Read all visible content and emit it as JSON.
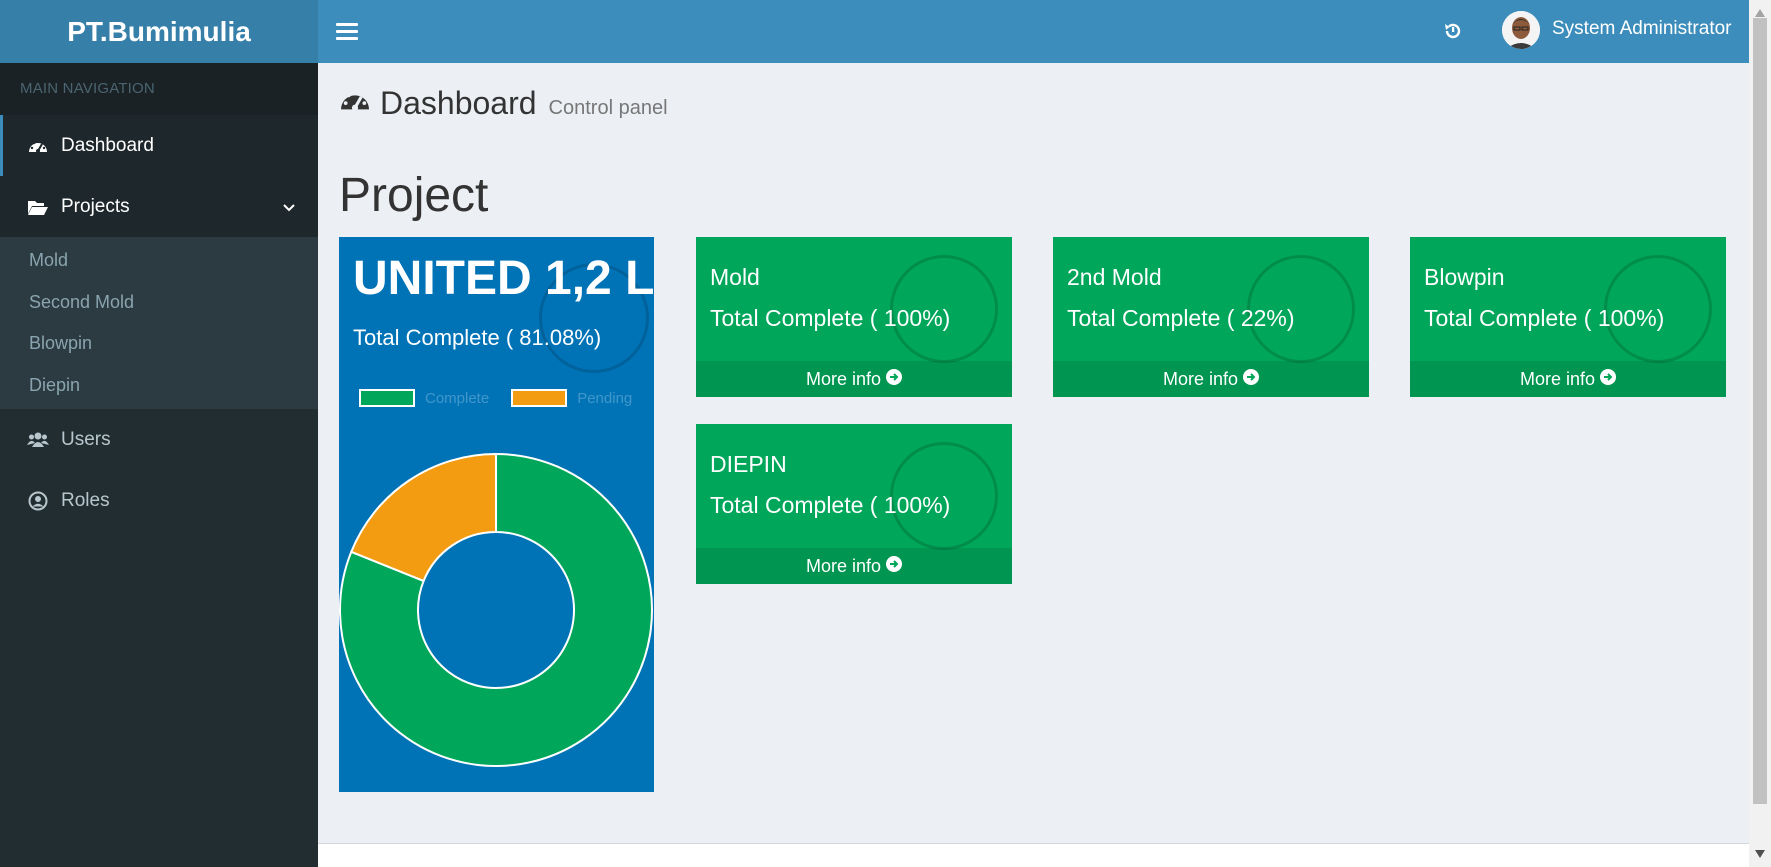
{
  "app": {
    "brand": "PT.Bumimulia"
  },
  "header": {
    "user_name": "System Administrator",
    "history_icon": "history-icon",
    "menu_icon": "hamburger-icon"
  },
  "sidebar": {
    "section_label": "MAIN NAVIGATION",
    "items": [
      {
        "label": "Dashboard",
        "icon": "dashboard-icon",
        "active": true
      },
      {
        "label": "Projects",
        "icon": "folder-open-icon",
        "expanded": true,
        "children": [
          {
            "label": "Mold"
          },
          {
            "label": "Second Mold"
          },
          {
            "label": "Blowpin"
          },
          {
            "label": "Diepin"
          }
        ]
      },
      {
        "label": "Users",
        "icon": "users-icon"
      },
      {
        "label": "Roles",
        "icon": "user-circle-icon"
      }
    ]
  },
  "page": {
    "title": "Dashboard",
    "subtitle": "Control panel",
    "section_title": "Project"
  },
  "summary_card": {
    "title": "UNITED 1,2 L",
    "subtitle": "Total Complete ( 81.08%)",
    "color": "#0073b7"
  },
  "chart_data": {
    "type": "pie",
    "donut": true,
    "labels": [
      "Complete",
      "Pending"
    ],
    "values": [
      81.08,
      18.92
    ],
    "colors": [
      "#00a65a",
      "#f39c12"
    ],
    "legend": "top"
  },
  "cards": [
    {
      "title": "Mold",
      "subtitle": "Total Complete ( 100%)",
      "footer": "More info"
    },
    {
      "title": "2nd Mold",
      "subtitle": "Total Complete ( 22%)",
      "footer": "More info"
    },
    {
      "title": "Blowpin",
      "subtitle": "Total Complete ( 100%)",
      "footer": "More info"
    },
    {
      "title": "DIEPIN",
      "subtitle": "Total Complete ( 100%)",
      "footer": "More info"
    }
  ],
  "colors": {
    "header": "#3c8dbc",
    "logo": "#367fa9",
    "sidebar": "#222d32",
    "card": "#00a65a"
  }
}
